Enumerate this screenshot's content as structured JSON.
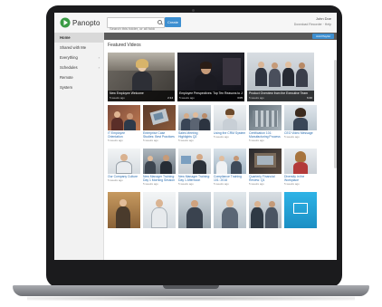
{
  "header": {
    "logo_text": "Panopto",
    "search_placeholder": "Search this folder, or all folders",
    "create_label": "Create",
    "user_name": "John Doe",
    "account_links": "Download Recorder · Help"
  },
  "sidebar": {
    "items": [
      {
        "label": "Home",
        "active": true
      },
      {
        "label": "Shared with Me",
        "active": false
      },
      {
        "label": "Everything",
        "active": false,
        "chevron": true
      },
      {
        "label": "Schedules",
        "active": false,
        "chevron": true
      },
      {
        "label": "Remote",
        "active": false
      },
      {
        "label": "System",
        "active": false
      }
    ]
  },
  "main": {
    "action_button": "Add Playlist",
    "section_title": "Featured Videos",
    "featured": [
      {
        "title": "New Employee Welcome",
        "date": "5 weeks ago",
        "duration": "2:14"
      },
      {
        "title": "Employee Perspectives: Top Ten Reasons to Join",
        "date": "5 weeks ago",
        "duration": "3:05"
      },
      {
        "title": "Product Overview from the Executive Team",
        "date": "5 weeks ago",
        "duration": "6:40"
      }
    ],
    "grid": [
      {
        "title": "IT Employee Orientation",
        "date": "5 weeks ago"
      },
      {
        "title": "Enterprise Case Studies: Best Practices",
        "date": "5 weeks ago"
      },
      {
        "title": "Sales Meeting Highlights Q2",
        "date": "5 weeks ago"
      },
      {
        "title": "Using the CRM System",
        "date": "5 weeks ago"
      },
      {
        "title": "Certification 101: Manufacturing Process",
        "date": "5 weeks ago"
      },
      {
        "title": "CEO Video Message",
        "date": "5 weeks ago"
      },
      {
        "title": "Our Company Culture",
        "date": "5 weeks ago"
      },
      {
        "title": "New Manager Training: Day 1 Morning Session",
        "date": "5 weeks ago"
      },
      {
        "title": "New Manager Training: Day 1 Afternoon",
        "date": "5 weeks ago"
      },
      {
        "title": "Compliance Training 101: 2016",
        "date": "5 weeks ago"
      },
      {
        "title": "Quarterly Financial Review: Q1",
        "date": "5 weeks ago"
      },
      {
        "title": "Diversity in the Workplace",
        "date": "5 weeks ago"
      },
      {
        "title": "",
        "date": ""
      },
      {
        "title": "",
        "date": ""
      },
      {
        "title": "",
        "date": ""
      },
      {
        "title": "",
        "date": ""
      },
      {
        "title": "",
        "date": ""
      },
      {
        "title": "",
        "date": ""
      }
    ]
  },
  "colors": {
    "accent": "#3d8fd1",
    "link": "#2a6db0",
    "title_bar": "#5a5a5a"
  }
}
